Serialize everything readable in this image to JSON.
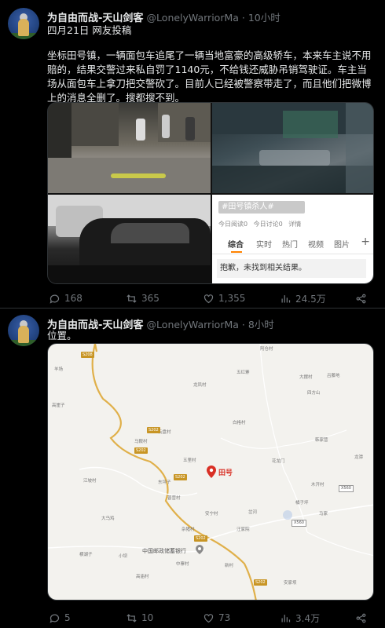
{
  "colors": {
    "background": "#000000",
    "text": "#e7e9ea",
    "muted": "#71767b",
    "pin": "#d93025",
    "road": "#e0b04a"
  },
  "tweets": [
    {
      "author_name": "为自由而战-天山剑客",
      "handle": "@LonelyWarriorMa",
      "separator": " · ",
      "time": "10小时",
      "subline": "四月21日 网友投稿",
      "body": "坐标田号镇，一辆面包车追尾了一辆当地富豪的高级轿车，本来车主说不用赔的，结果交警过来私自罚了1140元，不给钱还威胁吊销驾驶证。车主当场从面包车上拿刀把交警砍了。目前人已经被警察带走了，而且他们把微博上的消息全删了。搜都搜不到。",
      "media": {
        "weibo_search": {
          "title": "#田号镇杀人#",
          "filters": [
            "今日阅读0",
            "今日讨论0",
            "详情"
          ],
          "tabs": [
            "综合",
            "实时",
            "热门",
            "视频",
            "图片"
          ],
          "plus": "+",
          "empty_message": "抱歉，未找到相关结果。"
        }
      },
      "actions": {
        "reply_icon": "reply-icon",
        "replies": "168",
        "retweet_icon": "retweet-icon",
        "retweets": "365",
        "like_icon": "heart-icon",
        "likes": "1,355",
        "views_icon": "views-icon",
        "views": "24.5万",
        "share_icon": "share-icon"
      }
    },
    {
      "author_name": "为自由而战-天山剑客",
      "handle": "@LonelyWarriorMa",
      "separator": " · ",
      "time": "8小时",
      "body": "位置。",
      "map": {
        "pin_label": "田号",
        "bank_label": "中国邮政储蓄银行",
        "places": [
          "阿仓村",
          "五红寨",
          "大摆村",
          "龙凤村",
          "四方山",
          "白格村",
          "云盘村",
          "吕藤地",
          "羊场",
          "马鞍村",
          "高崖子",
          "五里村",
          "花龙门",
          "韩家营",
          "东坪子",
          "江坡村",
          "木开村",
          "普营村",
          "岔河",
          "汪家院",
          "大乌鸡",
          "橘子坪",
          "安宁村",
          "横湖子",
          "小坝",
          "新村",
          "中寨村",
          "马家",
          "高庙村",
          "安家坝",
          "龙潭",
          "杂猪村"
        ],
        "road_shields": [
          "S208",
          "S202",
          "S202",
          "S202",
          "S202",
          "S202"
        ],
        "grey_shields": [
          "X560",
          "X560"
        ]
      },
      "actions": {
        "replies": "5",
        "retweets": "10",
        "likes": "73",
        "views": "3.4万"
      }
    }
  ]
}
